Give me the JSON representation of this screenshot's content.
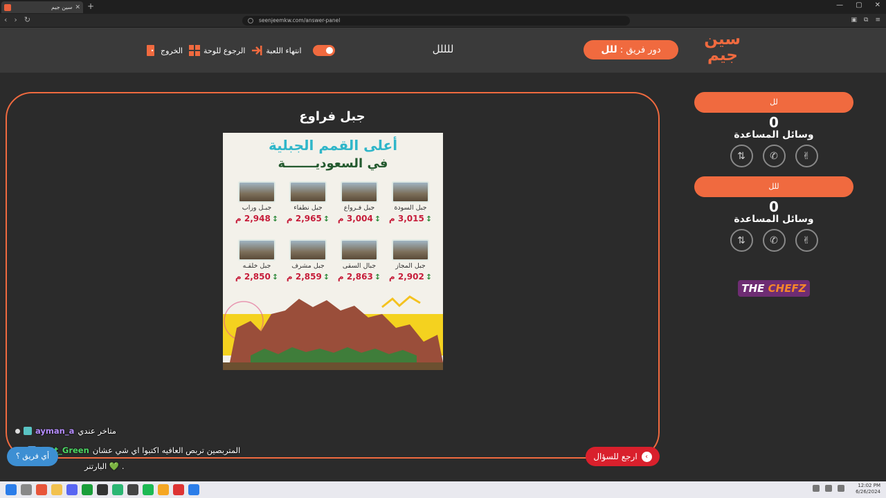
{
  "browser": {
    "tab_title": "سين جيم",
    "url": "seenjeemkw.com/answer-panel"
  },
  "header": {
    "logo_text": "سين جيم",
    "turn_label": "دور فريق :",
    "turn_team": "للل",
    "game_title": "للللل",
    "end_game": "انتهاء اللعبة",
    "back_to_board": "الرجوع للوحة",
    "exit": "الخروج"
  },
  "question": {
    "title": "جبل فراوع",
    "poster": {
      "heading1": "أعلى القمم الجبلية",
      "heading2": "في السعوديـــــــة",
      "mountains": [
        {
          "name": "جبل السودة",
          "height": "3,015 م"
        },
        {
          "name": "جبل فـرواع",
          "height": "3,004 م"
        },
        {
          "name": "جبل نطفاء",
          "height": "2,965 م"
        },
        {
          "name": "جبـل وراب",
          "height": "2,948 م"
        },
        {
          "name": "جبل المجاز",
          "height": "2,902 م"
        },
        {
          "name": "جبال السقى",
          "height": "2,863 م"
        },
        {
          "name": "جبل مشرف",
          "height": "2,859 م"
        },
        {
          "name": "جبل خلقـه",
          "height": "2,850 م"
        }
      ]
    }
  },
  "teams": [
    {
      "name": "لل",
      "score": "0",
      "aids_label": "وسائل المساعدة"
    },
    {
      "name": "للل",
      "score": "0",
      "aids_label": "وسائل المساعدة"
    }
  ],
  "sponsor": {
    "part1": "THE ",
    "part2": "CHEFZ"
  },
  "chat": [
    {
      "user": "ayman_a",
      "user_color": "#b58cff",
      "message": "متاخر عندي"
    },
    {
      "user": "bott_Green",
      "user_color": "#4cd964",
      "message": "المتربصين تربص العافيه اكتبوا اي شي عشان",
      "message2": "البارتنر 💚 ."
    }
  ],
  "buttons": {
    "help": "أي فريق ؟",
    "back_to_question": "ارجع للسؤال"
  },
  "taskbar": {
    "time": "12:02 PM",
    "date": "6/26/2024"
  },
  "colors": {
    "accent": "#f06a3f",
    "back_button": "#d9202c",
    "help_button": "#3d8fd3"
  }
}
